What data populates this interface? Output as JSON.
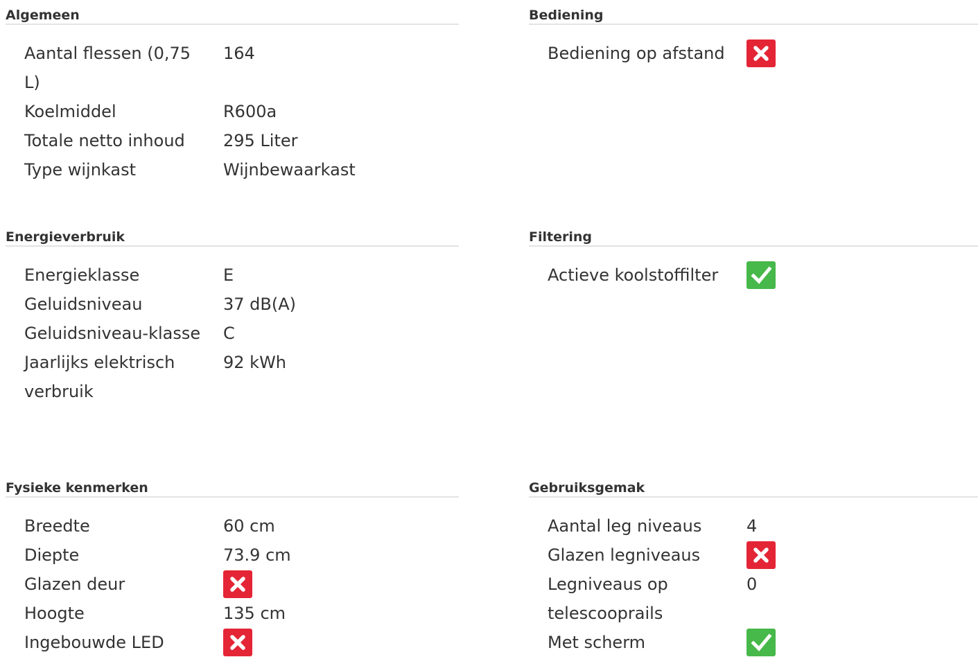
{
  "sections": {
    "algemeen": {
      "title": "Algemeen",
      "rows": [
        {
          "label": "Aantal flessen (0,75 L)",
          "value": "164"
        },
        {
          "label": "Koelmiddel",
          "value": "R600a"
        },
        {
          "label": "Totale netto inhoud",
          "value": "295 Liter"
        },
        {
          "label": "Type wijnkast",
          "value": "Wijnbewaarkast"
        }
      ]
    },
    "bediening": {
      "title": "Bediening",
      "rows": [
        {
          "label": "Bediening op afstand",
          "value": false
        }
      ]
    },
    "energieverbruik": {
      "title": "Energieverbruik",
      "rows": [
        {
          "label": "Energieklasse",
          "value": "E"
        },
        {
          "label": "Geluidsniveau",
          "value": "37 dB(A)"
        },
        {
          "label": "Geluidsniveau-klasse",
          "value": "C"
        },
        {
          "label": "Jaarlijks elektrisch verbruik",
          "value": "92 kWh"
        }
      ]
    },
    "filtering": {
      "title": "Filtering",
      "rows": [
        {
          "label": "Actieve koolstoffilter",
          "value": true
        }
      ]
    },
    "fysieke": {
      "title": "Fysieke kenmerken",
      "rows": [
        {
          "label": "Breedte",
          "value": "60 cm"
        },
        {
          "label": "Diepte",
          "value": "73.9 cm"
        },
        {
          "label": "Glazen deur",
          "value": false
        },
        {
          "label": "Hoogte",
          "value": "135 cm"
        },
        {
          "label": "Ingebouwde LED",
          "value": false
        }
      ]
    },
    "gebruiksgemak": {
      "title": "Gebruiksgemak",
      "rows": [
        {
          "label": "Aantal leg niveaus",
          "value": "4"
        },
        {
          "label": "Glazen legniveaus",
          "value": false
        },
        {
          "label": "Legniveaus op telescooprails",
          "value": "0"
        },
        {
          "label": "Met scherm",
          "value": true
        }
      ]
    }
  },
  "icons": {
    "yes": "check-icon",
    "no": "cross-icon"
  },
  "colors": {
    "yes": "#47b84a",
    "no": "#e42536",
    "divider": "#e3e3e3",
    "text": "#333333"
  }
}
